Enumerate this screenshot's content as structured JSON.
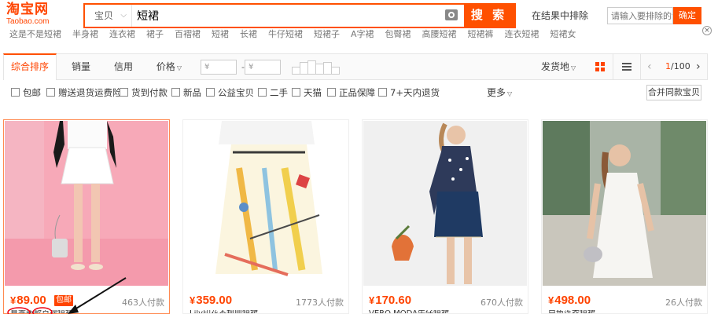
{
  "logo": {
    "cn": "淘宝网",
    "en": "Taobao.com"
  },
  "search": {
    "type_label": "宝贝",
    "query": "短裙",
    "button_label": "搜 索"
  },
  "in_result": {
    "label": "在结果中排除",
    "placeholder": "请输入要排除的词",
    "button_label": "确定"
  },
  "hot_words": [
    "这是不是短裙",
    "半身裙",
    "连衣裙",
    "裙子",
    "百褶裙",
    "短裙",
    "长裙",
    "牛仔短裙",
    "短裙子",
    "A字裙",
    "包臀裙",
    "高腰短裙",
    "短裙裤",
    "连衣短裙",
    "短裙女"
  ],
  "sortbar": {
    "tabs": [
      "综合排序",
      "销量",
      "信用",
      "价格"
    ],
    "price_from": "¥",
    "price_to": "¥",
    "price_dash": "-",
    "deliver": "发货地",
    "page_current": "1",
    "page_total": "/100"
  },
  "filters": {
    "checkboxes": [
      "包邮",
      "赠送退货运费险",
      "货到付款",
      "新品",
      "公益宝贝",
      "二手",
      "天猫",
      "正品保障",
      "7+天内退货"
    ],
    "more": "更多",
    "merge": "合并同款宝贝"
  },
  "items": [
    {
      "currency": "¥",
      "price": "89.00",
      "badge": "包邮",
      "deals": "463人付款",
      "brand": "",
      "title": "夏季新款百褶短裙"
    },
    {
      "currency": "¥",
      "price": "359.00",
      "badge": "",
      "deals": "1773人付款",
      "brand": "lily",
      "title": "Lily印花不规则短裙"
    },
    {
      "currency": "¥",
      "price": "170.60",
      "badge": "",
      "deals": "670人付款",
      "brand": "VERO MODA",
      "title": "VERO MODA牛仔短裙"
    },
    {
      "currency": "¥",
      "price": "498.00",
      "badge": "",
      "deals": "26人付款",
      "brand": "",
      "title": "白色连衣短裙"
    }
  ],
  "colors": {
    "accent": "#ff5000",
    "price": "#ff4400"
  }
}
